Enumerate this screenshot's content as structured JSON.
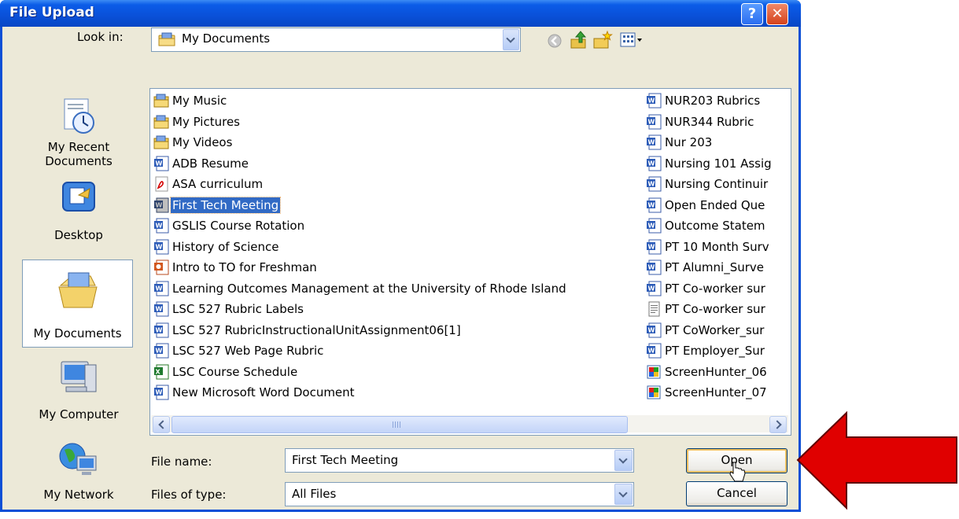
{
  "window": {
    "title": "File Upload",
    "help_label": "?",
    "close_label": "✕"
  },
  "lookin": {
    "label": "Look in:",
    "value": "My Documents"
  },
  "toolbar": {
    "icons": [
      "back-icon",
      "up-folder-icon",
      "new-folder-icon",
      "views-menu-icon"
    ]
  },
  "places": [
    {
      "label": "My Recent Documents",
      "icon": "recent-documents-icon"
    },
    {
      "label": "Desktop",
      "icon": "desktop-icon"
    },
    {
      "label": "My Documents",
      "icon": "my-documents-icon"
    },
    {
      "label": "My Computer",
      "icon": "my-computer-icon"
    },
    {
      "label": "My Network",
      "icon": "my-network-icon"
    }
  ],
  "files_col1": [
    {
      "name": "My Music",
      "type": "folder"
    },
    {
      "name": "My Pictures",
      "type": "folder"
    },
    {
      "name": "My Videos",
      "type": "folder"
    },
    {
      "name": "ADB Resume",
      "type": "word"
    },
    {
      "name": "ASA curriculum",
      "type": "pdf"
    },
    {
      "name": "First Tech Meeting",
      "type": "word"
    },
    {
      "name": "GSLIS Course Rotation",
      "type": "word"
    },
    {
      "name": "History of Science",
      "type": "word"
    },
    {
      "name": "Intro to TO for Freshman",
      "type": "powerpoint"
    },
    {
      "name": "Learning Outcomes Management at the University of Rhode Island",
      "type": "word"
    },
    {
      "name": "LSC 527 Rubric Labels",
      "type": "word"
    },
    {
      "name": "LSC 527 RubricInstructionalUnitAssignment06[1]",
      "type": "word"
    },
    {
      "name": "LSC 527 Web Page Rubric",
      "type": "word"
    },
    {
      "name": "LSC Course Schedule",
      "type": "excel"
    },
    {
      "name": "New Microsoft Word Document",
      "type": "word"
    }
  ],
  "files_col2": [
    {
      "name": "NUR203 Rubrics",
      "type": "word"
    },
    {
      "name": "NUR344 Rubric",
      "type": "word"
    },
    {
      "name": "Nur 203",
      "type": "word"
    },
    {
      "name": "Nursing 101 Assig",
      "type": "word"
    },
    {
      "name": "Nursing Continuir",
      "type": "word"
    },
    {
      "name": "Open Ended Que",
      "type": "word"
    },
    {
      "name": "Outcome Statem",
      "type": "word"
    },
    {
      "name": "PT 10 Month Surv",
      "type": "word"
    },
    {
      "name": "PT Alumni_Surve",
      "type": "word"
    },
    {
      "name": "PT Co-worker sur",
      "type": "word"
    },
    {
      "name": "PT Co-worker sur",
      "type": "text"
    },
    {
      "name": "PT CoWorker_sur",
      "type": "word"
    },
    {
      "name": "PT Employer_Sur",
      "type": "word"
    },
    {
      "name": "ScreenHunter_06",
      "type": "image"
    },
    {
      "name": "ScreenHunter_07",
      "type": "image"
    }
  ],
  "selected_file": "First Tech Meeting",
  "filename": {
    "label": "File name:",
    "value": "First Tech Meeting"
  },
  "filetype": {
    "label": "Files of type:",
    "value": "All Files"
  },
  "buttons": {
    "open": "Open",
    "cancel": "Cancel"
  },
  "colors": {
    "titlebar": "#0a50d8",
    "selection": "#316ac5",
    "annotation_arrow": "#e00000"
  }
}
